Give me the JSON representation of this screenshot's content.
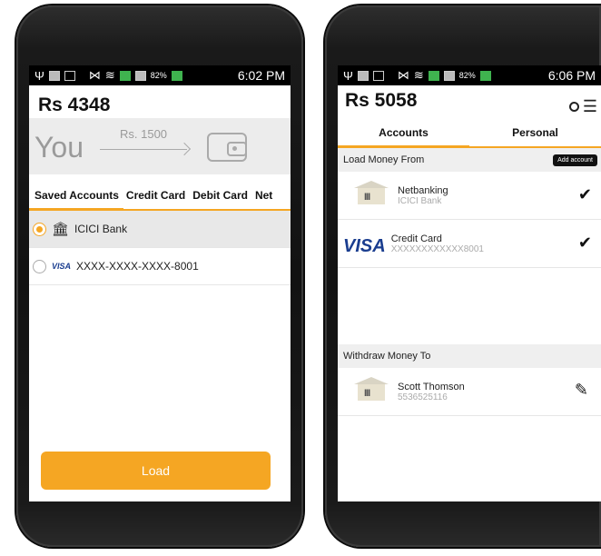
{
  "left_screen": {
    "status_time": "6:02 PM",
    "battery": "82%",
    "balance": "Rs 4348",
    "flow": {
      "you_label": "You",
      "amount": "Rs. 1500"
    },
    "tabs": [
      "Saved Accounts",
      "Credit Card",
      "Debit Card",
      "Net"
    ],
    "accounts": [
      {
        "label": "ICICI Bank",
        "selected": true,
        "icon": "bank-icon"
      },
      {
        "label": "XXXX-XXXX-XXXX-8001",
        "selected": false,
        "icon": "visa-logo",
        "brand": "VISA"
      }
    ],
    "load_button": "Load"
  },
  "right_screen": {
    "status_time": "6:06 PM",
    "battery": "82%",
    "balance": "Rs 5058",
    "tabs": [
      "Accounts",
      "Personal"
    ],
    "load_section": {
      "title": "Load Money From",
      "add_button": "Add account",
      "items": [
        {
          "name": "Netbanking",
          "detail": "ICICI Bank",
          "icon": "bank-icon"
        },
        {
          "name": "Credit Card",
          "detail": "XXXXXXXXXXXX8001",
          "icon": "visa-logo",
          "brand": "VISA"
        }
      ]
    },
    "withdraw_section": {
      "title": "Withdraw Money To",
      "items": [
        {
          "name": "Scott Thomson",
          "detail": "5536525116",
          "icon": "bank-icon"
        }
      ]
    }
  },
  "colors": {
    "accent": "#f5a623",
    "visa": "#1a3d8f"
  }
}
